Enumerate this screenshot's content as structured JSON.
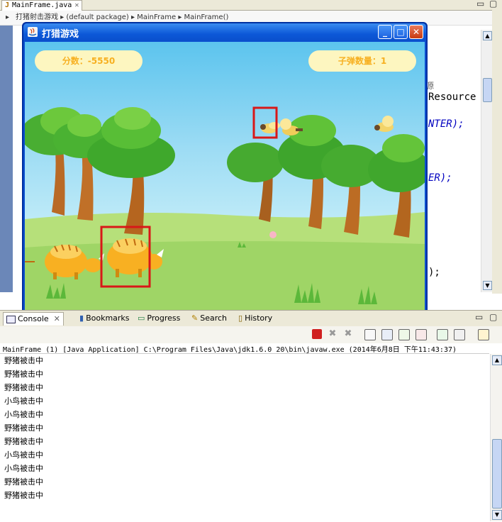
{
  "editor": {
    "tab_label": "MainFrame.java",
    "breadcrumb": "打猪射击游戏 ▸ (default package) ▸ MainFrame ▸ MainFrame()",
    "code_fragments": [
      "源",
      "Resource",
      "NTER);",
      "ER);",
      ");"
    ]
  },
  "game": {
    "window_title": "打猎游戏",
    "score_label": "分数：-5550",
    "bullets_label": "子弹数量：1",
    "minimize_glyph": "_",
    "maximize_glyph": "□",
    "close_glyph": "✕"
  },
  "console": {
    "tabs": [
      {
        "label": "Console",
        "icon": "console-icon",
        "active": true
      },
      {
        "label": "Bookmarks",
        "icon": "bookmark-icon"
      },
      {
        "label": "Progress",
        "icon": "progress-icon"
      },
      {
        "label": "Search",
        "icon": "search-icon"
      },
      {
        "label": "History",
        "icon": "history-icon"
      }
    ],
    "launch_info": "MainFrame (1) [Java Application] C:\\Program Files\\Java\\jdk1.6.0_20\\bin\\javaw.exe (2014年6月8日 下午11:43:37)",
    "output_lines": [
      "野猪被击中",
      "野猪被击中",
      "野猪被击中",
      "小鸟被击中",
      "小鸟被击中",
      "野猪被击中",
      "野猪被击中",
      "小鸟被击中",
      "小鸟被击中",
      "野猪被击中",
      "野猪被击中"
    ]
  },
  "colors": {
    "hud_text": "#f7b020",
    "hud_bg": "#fdf6c0",
    "hit_box": "#d81818",
    "title_bar": "#0c58d8"
  }
}
